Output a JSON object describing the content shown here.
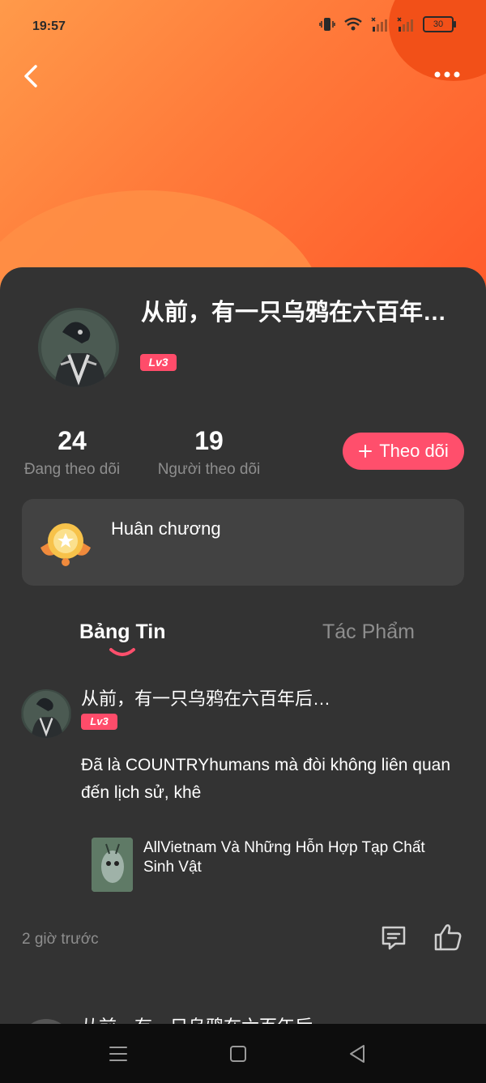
{
  "status_bar": {
    "time": "19:57",
    "battery": "30"
  },
  "profile": {
    "name": "从前，有一只乌鸦在六百年…",
    "level": "Lv3",
    "following_count": "24",
    "following_label": "Đang theo dõi",
    "followers_count": "19",
    "followers_label": "Người theo dõi",
    "follow_button": "Theo dõi"
  },
  "medal": {
    "label": "Huân chương"
  },
  "tabs": [
    {
      "label": "Bảng Tin",
      "active": true
    },
    {
      "label": "Tác Phẩm",
      "active": false
    }
  ],
  "post": {
    "author": "从前，有一只乌鸦在六百年后…",
    "level": "Lv3",
    "text": "Đã là COUNTRYhumans mà đòi không liên quan đến lịch sử, khê",
    "linked_work": "AllVietnam Và Những Hỗn Hợp Tạp Chất Sinh Vật",
    "time": "2 giờ trước"
  },
  "next_post": {
    "author": "从前，有一只乌鸦在六百年后"
  },
  "colors": {
    "accent": "#ff4f6c",
    "header_orange": "#ff7a3a",
    "background": "#333333"
  }
}
